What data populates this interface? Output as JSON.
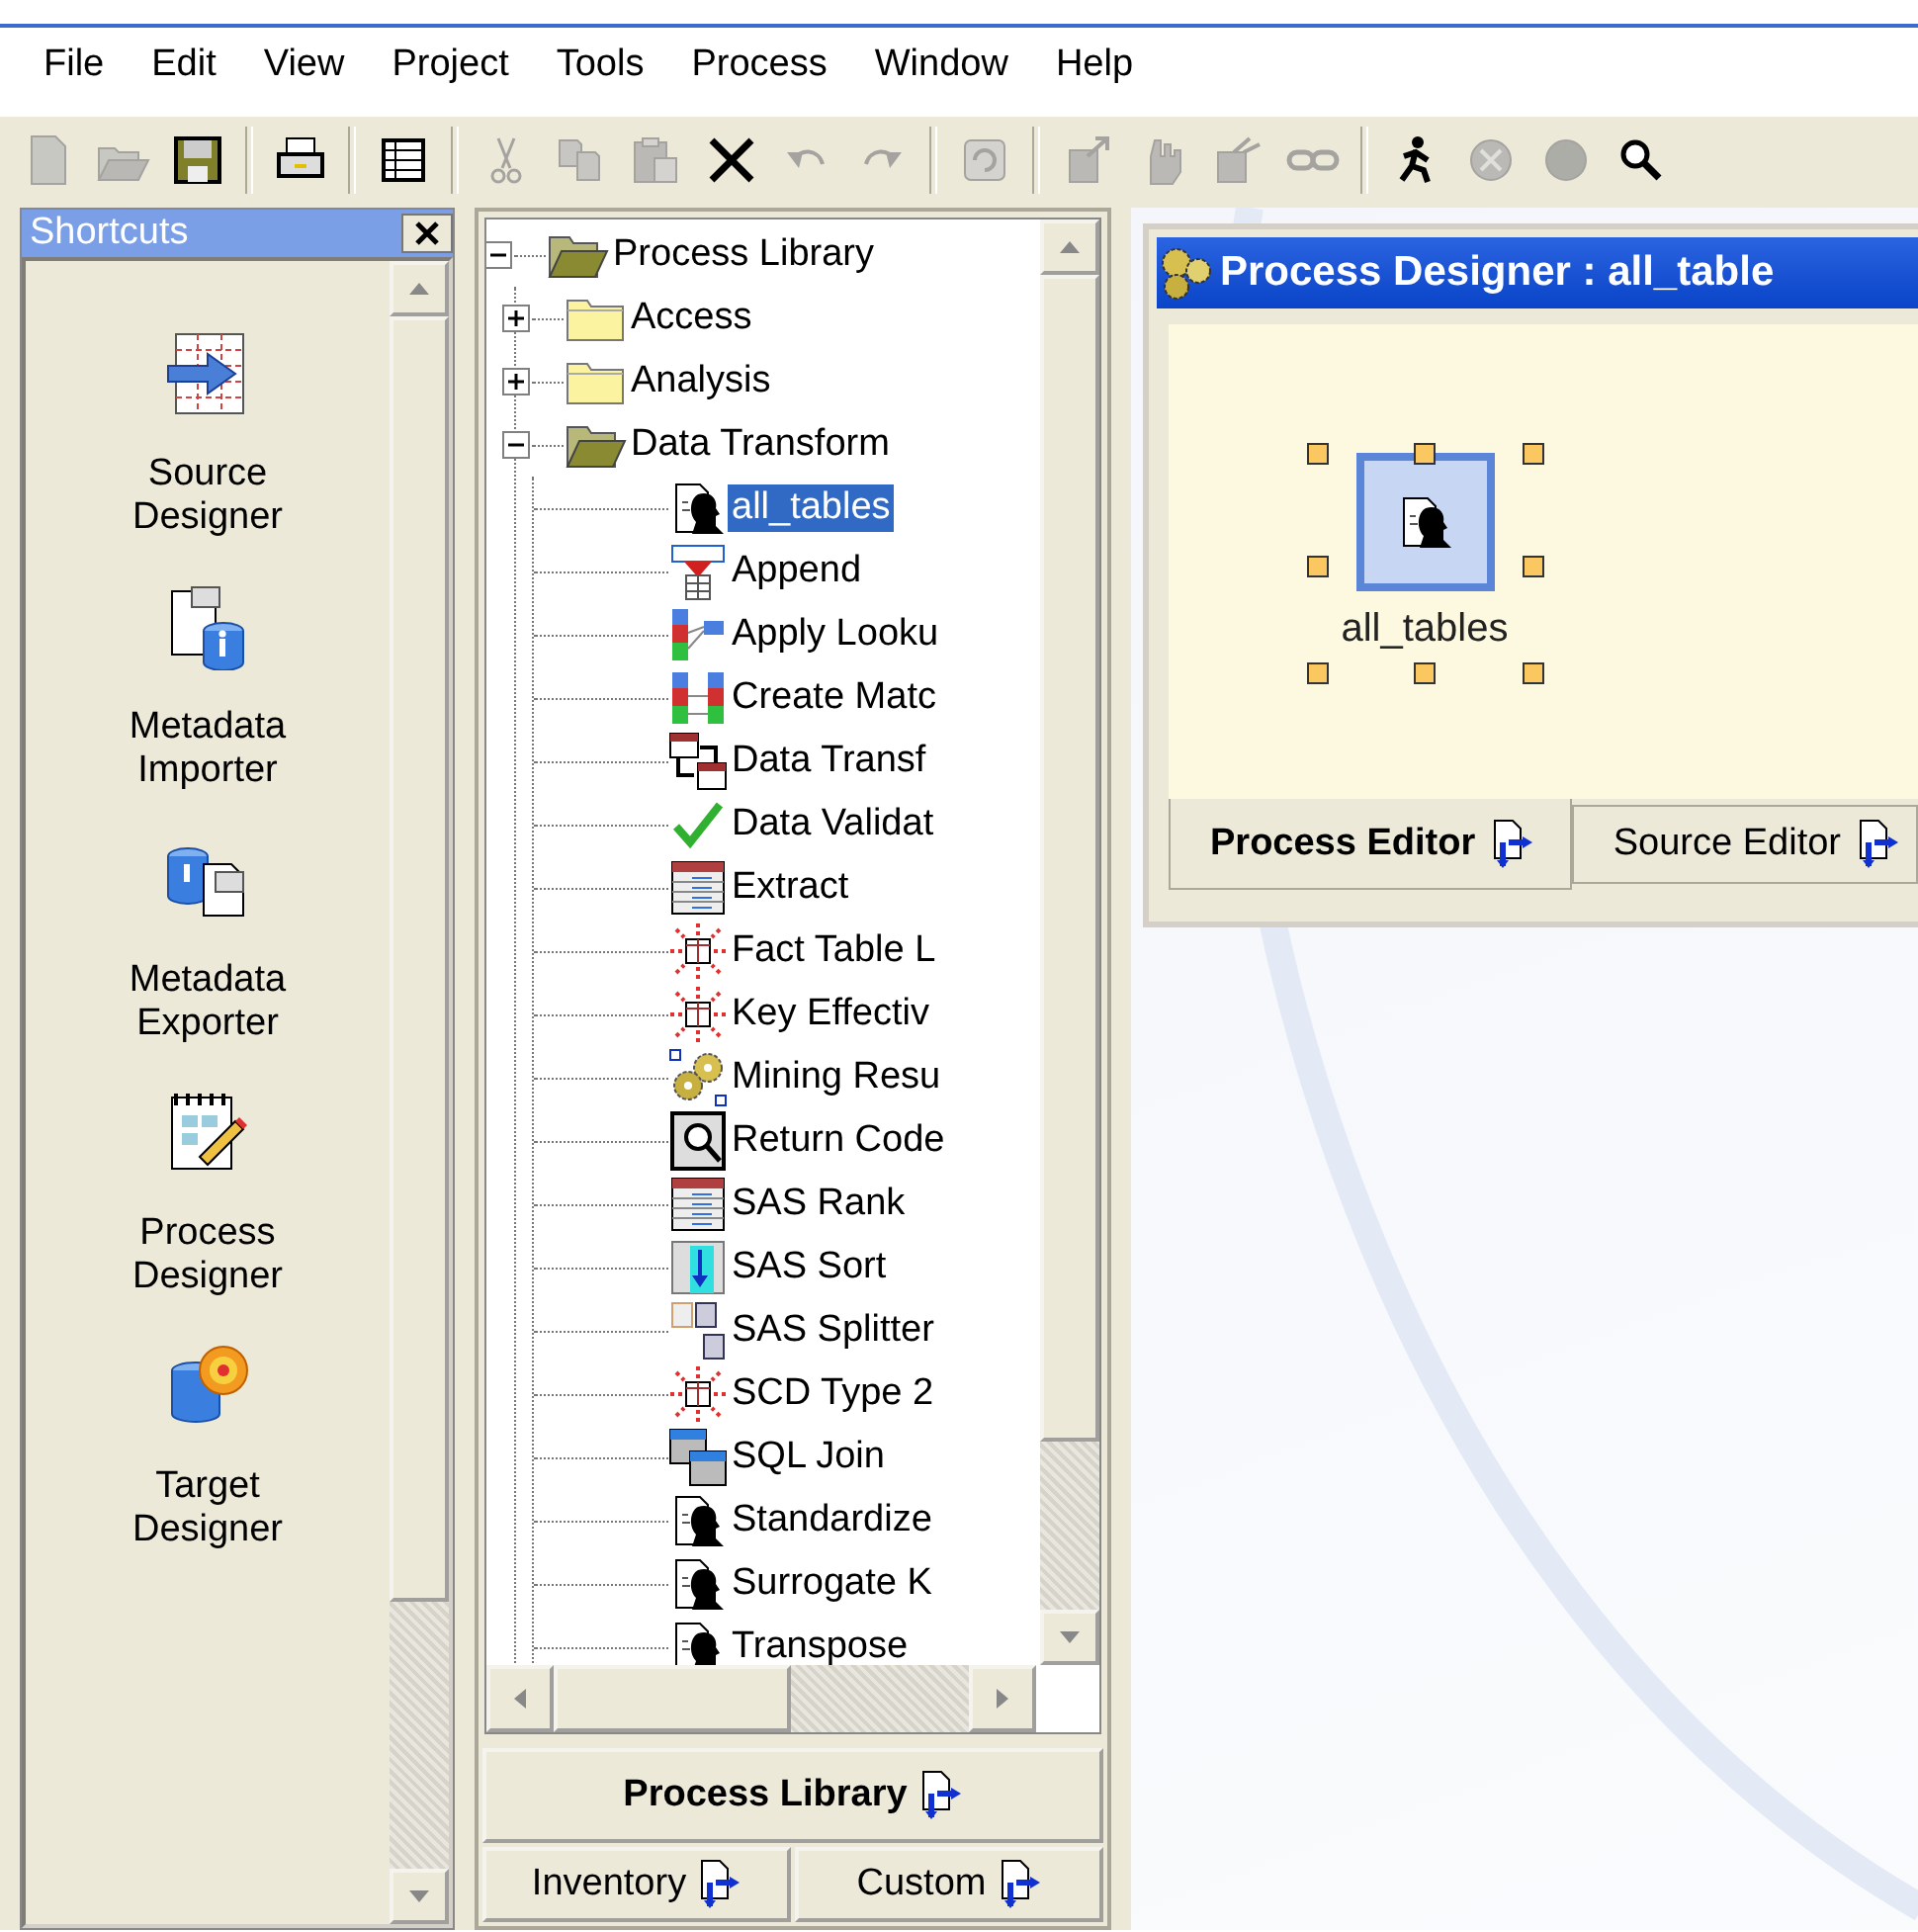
{
  "menu": [
    {
      "label": "File"
    },
    {
      "label": "Edit"
    },
    {
      "label": "View"
    },
    {
      "label": "Project"
    },
    {
      "label": "Tools"
    },
    {
      "label": "Process"
    },
    {
      "label": "Window"
    },
    {
      "label": "Help"
    }
  ],
  "toolbar": [
    {
      "kind": "new",
      "disabled": true
    },
    {
      "kind": "open",
      "disabled": true
    },
    {
      "kind": "save",
      "disabled": false
    },
    {
      "kind": "separator"
    },
    {
      "kind": "print",
      "disabled": false
    },
    {
      "kind": "separator"
    },
    {
      "kind": "table",
      "disabled": false
    },
    {
      "kind": "separator"
    },
    {
      "kind": "cut",
      "disabled": true
    },
    {
      "kind": "copy",
      "disabled": true
    },
    {
      "kind": "paste",
      "disabled": true
    },
    {
      "kind": "delete",
      "disabled": false
    },
    {
      "kind": "undo",
      "disabled": true
    },
    {
      "kind": "redo",
      "disabled": true
    },
    {
      "kind": "separator"
    },
    {
      "kind": "refresh",
      "disabled": true
    },
    {
      "kind": "separator"
    },
    {
      "kind": "export",
      "disabled": true
    },
    {
      "kind": "hand",
      "disabled": true
    },
    {
      "kind": "branch",
      "disabled": true
    },
    {
      "kind": "link",
      "disabled": true
    },
    {
      "kind": "separator"
    },
    {
      "kind": "run",
      "disabled": false
    },
    {
      "kind": "stop",
      "disabled": true
    },
    {
      "kind": "dot",
      "disabled": true
    },
    {
      "kind": "zoom",
      "disabled": false
    }
  ],
  "shortcuts": {
    "title": "Shortcuts",
    "items": [
      {
        "kind": "source",
        "label": "Source Designer"
      },
      {
        "kind": "importer",
        "label": "Metadata Importer"
      },
      {
        "kind": "exporter",
        "label": "Metadata Exporter"
      },
      {
        "kind": "process",
        "label": "Process Designer"
      },
      {
        "kind": "target",
        "label": "Target Designer"
      }
    ]
  },
  "tree": {
    "label": "Process Library",
    "kind": "folder",
    "expanded": true,
    "selected": false,
    "children": [
      {
        "label": "Access",
        "kind": "folder",
        "expanded": false,
        "selected": false
      },
      {
        "label": "Analysis",
        "kind": "folder",
        "expanded": false,
        "selected": false
      },
      {
        "label": "Data Transform",
        "kind": "folder",
        "expanded": true,
        "selected": false,
        "children": [
          {
            "label": "all_tables",
            "kind": "process",
            "selected": true
          },
          {
            "label": "Append",
            "kind": "append",
            "selected": false
          },
          {
            "label": "Apply Looku",
            "kind": "lookup",
            "selected": false
          },
          {
            "label": "Create Matc",
            "kind": "match",
            "selected": false
          },
          {
            "label": "Data Transf",
            "kind": "transform",
            "selected": false
          },
          {
            "label": "Data Validat",
            "kind": "validate",
            "selected": false
          },
          {
            "label": "Extract",
            "kind": "extract",
            "selected": false
          },
          {
            "label": "Fact Table L",
            "kind": "star",
            "selected": false
          },
          {
            "label": "Key Effectiv",
            "kind": "star",
            "selected": false
          },
          {
            "label": "Mining Resu",
            "kind": "mining",
            "selected": false
          },
          {
            "label": "Return Code",
            "kind": "return",
            "selected": false
          },
          {
            "label": "SAS Rank",
            "kind": "extract",
            "selected": false
          },
          {
            "label": "SAS Sort",
            "kind": "sort",
            "selected": false
          },
          {
            "label": "SAS Splitter",
            "kind": "splitter",
            "selected": false
          },
          {
            "label": "SCD Type 2",
            "kind": "star",
            "selected": false
          },
          {
            "label": "SQL Join",
            "kind": "join",
            "selected": false
          },
          {
            "label": "Standardize",
            "kind": "process",
            "selected": false
          },
          {
            "label": "Surrogate K",
            "kind": "process",
            "selected": false
          },
          {
            "label": "Transpose",
            "kind": "process",
            "selected": false
          }
        ]
      }
    ]
  },
  "library_tabs": [
    {
      "label": "Process Library",
      "selected": true
    },
    {
      "label": "Inventory",
      "selected": false
    },
    {
      "label": "Custom",
      "selected": false
    }
  ],
  "designer": {
    "title": "Process Designer : all_table",
    "node": {
      "label": "all_tables",
      "selected": true
    },
    "tabs": [
      {
        "label": "Process Editor",
        "selected": true
      },
      {
        "label": "Source Editor",
        "selected": false
      }
    ]
  }
}
